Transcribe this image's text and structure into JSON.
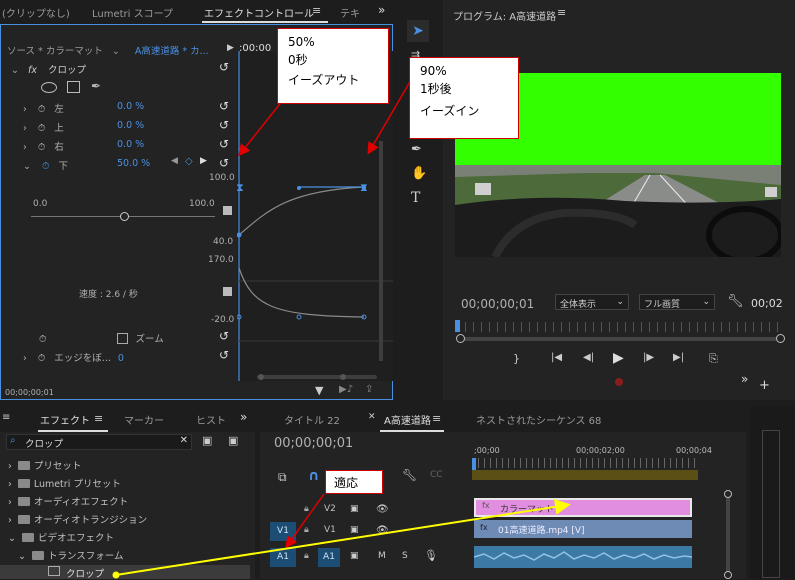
{
  "effect_controls": {
    "tabs": [
      "(クリップなし)",
      "Lumetri スコープ",
      "エフェクトコントロール",
      "テキ"
    ],
    "source_label": "ソース * カラーマット",
    "clip_label": "A高速道路 * カ...",
    "timecode_head": ";00;00",
    "effect_name": "クロップ",
    "params": [
      {
        "name": "左",
        "value": "0.0 %"
      },
      {
        "name": "上",
        "value": "0.0 %"
      },
      {
        "name": "右",
        "value": "0.0 %"
      },
      {
        "name": "下",
        "value": "50.0 %"
      }
    ],
    "graph_value_max": "100.0",
    "graph_value_min": "40.0",
    "slider_min": "0.0",
    "slider_max": "100.0",
    "velocity_max": "170.0",
    "velocity_min": "-20.0",
    "velocity_label": "速度 : 2.6 / 秒",
    "zoom_label": "ズーム",
    "edge_label": "エッジをぼ...",
    "edge_value": "0",
    "footer_timecode": "00;00;00;01"
  },
  "callout_left": {
    "line1": "50%",
    "line2": "0秒",
    "line3": "イーズアウト"
  },
  "callout_right": {
    "line1": "90%",
    "line2": "1秒後",
    "line3": "イーズイン"
  },
  "callout_apply": {
    "label": "適応"
  },
  "program": {
    "title": "プログラム: A高速道路",
    "timecode": "00;00;00;01",
    "fit_label": "全体表示",
    "quality_label": "フル画質",
    "right_timecode": "00;02"
  },
  "effects_panel": {
    "tabs": [
      "エフェクト",
      "マーカー",
      "ヒスト"
    ],
    "search_value": "クロップ",
    "tree": [
      {
        "label": "プリセット",
        "level": 0
      },
      {
        "label": "Lumetri プリセット",
        "level": 0
      },
      {
        "label": "オーディオエフェクト",
        "level": 0
      },
      {
        "label": "オーディオトランジション",
        "level": 0
      },
      {
        "label": "ビデオエフェクト",
        "level": 0
      },
      {
        "label": "トランスフォーム",
        "level": 1
      },
      {
        "label": "クロップ",
        "level": 2
      }
    ]
  },
  "timeline": {
    "tabs": [
      "タイトル 22",
      "A高速道路",
      "ネストされたシーケンス 68"
    ],
    "timecode": "00;00;00;01",
    "ruler": [
      ";00;00",
      "00;00;02;00",
      "00;00;04"
    ],
    "tracks": [
      "V2",
      "V1",
      "A1"
    ],
    "source_v": "V1",
    "source_a": "A1",
    "clip_color_matte": "カラーマット",
    "clip_video": "01高速道路.mp4 [V]",
    "m_label": "M",
    "s_label": "S"
  },
  "colors": {
    "accent_blue": "#4a90e2",
    "green_screen": "#33ff00",
    "magenta_clip": "#e28ee0",
    "video_clip": "#6d8bb5",
    "audio_clip": "#3c7aa5",
    "yellow_arrow": "#ffff00",
    "red_arrow": "#e00000"
  }
}
